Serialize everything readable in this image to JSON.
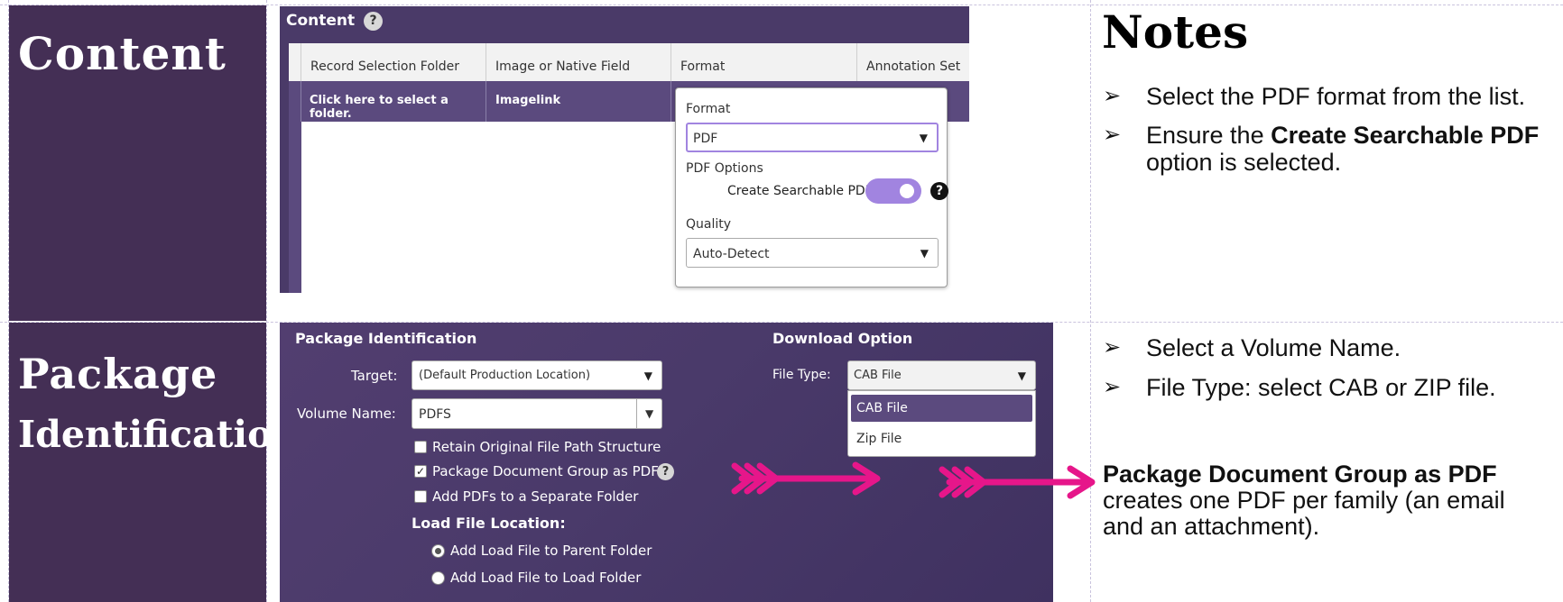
{
  "rows": {
    "content": {
      "title": "Content"
    },
    "package": {
      "title_line1": "Package",
      "title_line2": "Identification"
    }
  },
  "notes": {
    "heading": "Notes",
    "bullets_top": [
      {
        "text": "Select the PDF format from the list."
      },
      {
        "pre": "Ensure the ",
        "bold": "Create Searchable PDF",
        "post": " option is selected."
      }
    ],
    "bullets_bottom": [
      {
        "text": "Select a Volume Name."
      },
      {
        "text": "File Type: select CAB or ZIP file."
      }
    ],
    "callout": {
      "bold": "Package Document Group as PDF",
      "rest": "creates one PDF per family (an email and an attachment)."
    }
  },
  "content_panel": {
    "header": "Content",
    "columns": [
      "Record Selection Folder",
      "Image or Native Field",
      "Format",
      "Annotation Set"
    ],
    "row": {
      "folder": "Click here to select a folder.",
      "field": "Imagelink"
    },
    "popup": {
      "format_label": "Format",
      "format_value": "PDF",
      "pdf_options_label": "PDF Options",
      "searchable_label": "Create Searchable PDF",
      "searchable_on": true,
      "quality_label": "Quality",
      "quality_value": "Auto-Detect"
    }
  },
  "package_panel": {
    "section_title": "Package Identification",
    "target_label": "Target:",
    "target_value": "(Default Production Location)",
    "volume_label": "Volume Name:",
    "volume_value": "PDFS",
    "checkboxes": [
      {
        "label": "Retain Original File Path Structure",
        "checked": false
      },
      {
        "label": "Package Document Group as PDF",
        "checked": true
      },
      {
        "label": "Add PDFs to a Separate Folder",
        "checked": false
      }
    ],
    "load_file_title": "Load File Location:",
    "radios": [
      {
        "label": "Add Load File to Parent Folder",
        "selected": true
      },
      {
        "label": "Add Load File to Load Folder",
        "selected": false
      }
    ],
    "download_title": "Download Option",
    "file_type_label": "File Type:",
    "file_type_value": "CAB File",
    "file_type_options": [
      "CAB File",
      "Zip File"
    ]
  },
  "colors": {
    "left_cell": "#442f55",
    "ui_dark": "#4a3a68",
    "accent_purple": "#a184e0",
    "arrow_pink": "#e6168a"
  },
  "icons": {
    "help": "question-circle-icon",
    "dropdown": "triangle-down-icon",
    "arrow": "feathered-arrow-icon"
  }
}
